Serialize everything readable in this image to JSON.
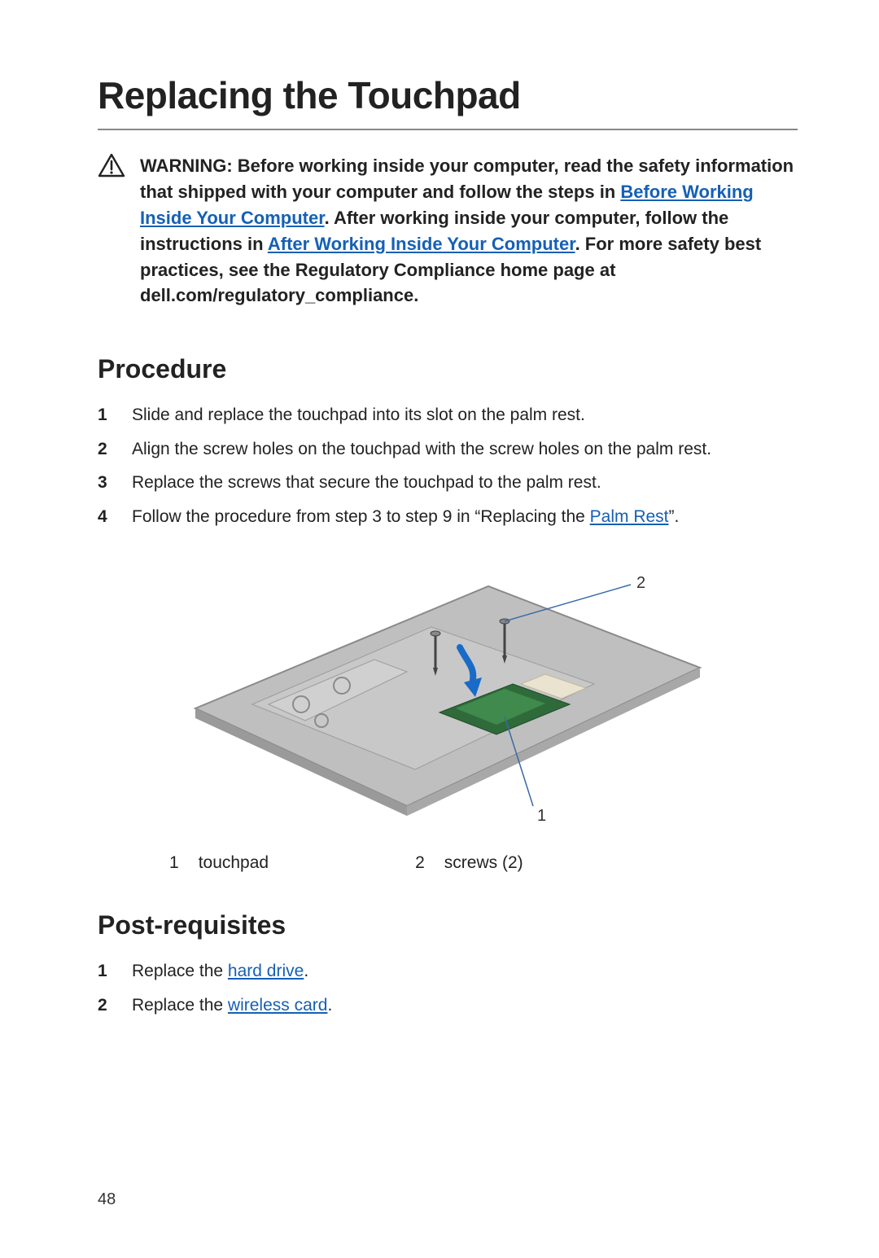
{
  "title": "Replacing the Touchpad",
  "warning": {
    "pre1": "WARNING: Before working inside your computer, read the safety information that shipped with your computer and follow the steps in ",
    "link1": "Before Working Inside Your Computer",
    "mid1": ". After working inside your computer, follow the instructions in ",
    "link2": "After Working Inside Your Computer",
    "post1": ". For more safety best practices, see the Regulatory Compliance home page at dell.com/regulatory_compliance."
  },
  "sections": {
    "procedure": {
      "heading": "Procedure",
      "steps": [
        {
          "n": "1",
          "text": "Slide and replace the touchpad into its slot on the palm rest."
        },
        {
          "n": "2",
          "text": "Align the screw holes on the touchpad with the screw holes on the palm rest."
        },
        {
          "n": "3",
          "text": "Replace the screws that secure the touchpad to the palm rest."
        },
        {
          "n": "4",
          "text_pre": "Follow the procedure from step 3 to step 9 in “Replacing the ",
          "link": "Palm Rest",
          "text_post": "”."
        }
      ]
    },
    "postreq": {
      "heading": "Post-requisites",
      "steps": [
        {
          "n": "1",
          "text_pre": "Replace the ",
          "link": "hard drive",
          "text_post": "."
        },
        {
          "n": "2",
          "text_pre": "Replace the ",
          "link": "wireless card",
          "text_post": "."
        }
      ]
    }
  },
  "figure": {
    "callout1": "1",
    "callout2": "2",
    "legend": [
      {
        "n": "1",
        "label": "touchpad"
      },
      {
        "n": "2",
        "label": "screws (2)"
      }
    ]
  },
  "page_number": "48"
}
